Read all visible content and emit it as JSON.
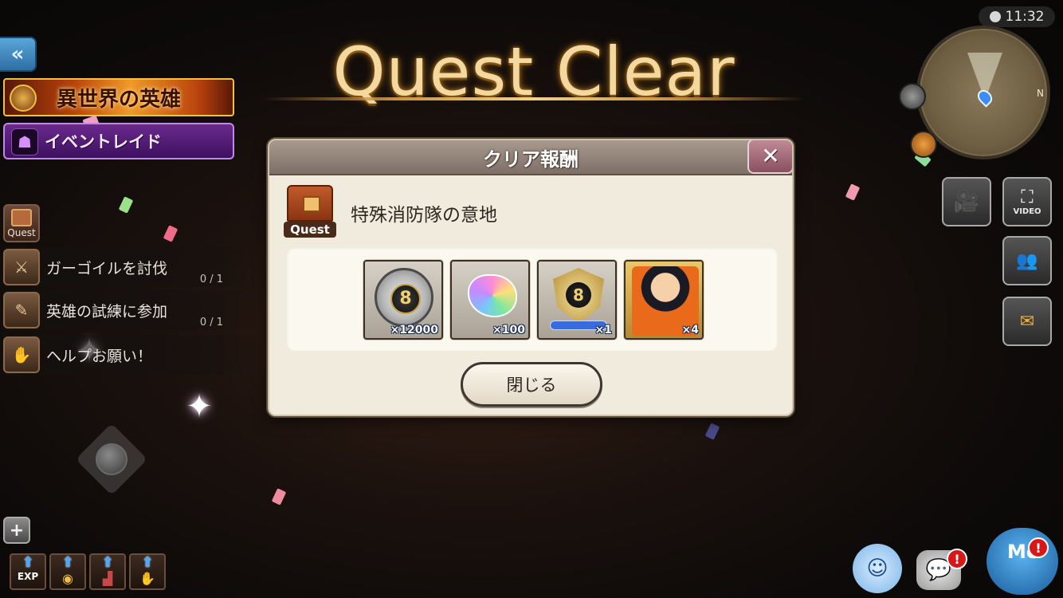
{
  "title": "Quest Clear",
  "hud": {
    "clock": "11:32",
    "event_banner": "異世界の英雄",
    "raid_button": "イベントレイド",
    "quest_tab_label": "Quest",
    "quests": [
      {
        "label": "ガーゴイルを討伐",
        "progress": "0 / 1"
      },
      {
        "label": "英雄の試練に参加",
        "progress": "0 / 1"
      },
      {
        "label": "ヘルプお願い！",
        "progress": ""
      }
    ],
    "boost_buttons": [
      "EXP",
      "",
      "",
      ""
    ],
    "video_button_label": "VIDEO",
    "minimap_north": "N",
    "mc_label": "Mc",
    "alert_mark": "!"
  },
  "dialog": {
    "title": "クリア報酬",
    "quest_badge_label": "Quest",
    "quest_name": "特殊消防隊の意地",
    "rewards": [
      {
        "icon": "coin-icon",
        "quantity": "×12000"
      },
      {
        "icon": "rainbow-crystal-icon",
        "quantity": "×100"
      },
      {
        "icon": "medal-icon",
        "quantity": "×1"
      },
      {
        "icon": "character-portrait-icon",
        "quantity": "×4"
      }
    ],
    "close_button_label": "閉じる"
  },
  "colors": {
    "dialog_bg": "#f1ebdd",
    "dialog_header": "#8e8076",
    "title_gold": "#f3d9a0",
    "raid_purple": "#5a2080",
    "close_x": "#a86a78"
  }
}
